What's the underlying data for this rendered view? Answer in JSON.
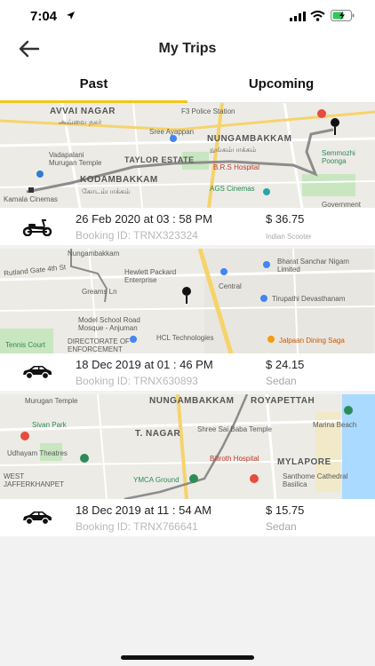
{
  "status_bar": {
    "time": "7:04",
    "icons": [
      "location-arrow-icon",
      "signal-icon",
      "wifi-icon",
      "battery-charging-icon"
    ]
  },
  "header": {
    "title": "My Trips",
    "back_icon": "arrow-left-icon"
  },
  "tabs": [
    {
      "label": "Past",
      "selected": true
    },
    {
      "label": "Upcoming",
      "selected": false
    }
  ],
  "colors": {
    "tab_indicator": "#f5c518",
    "route": "#8c8c8c",
    "map_park": "#c8e6c0",
    "map_road": "#f6d36b"
  },
  "trips": [
    {
      "vehicle_icon": "scooter-icon",
      "date": "26 Feb 2020 at 03 : 58 PM",
      "booking_id": "Booking ID: TRNX323324",
      "price": "$ 36.75",
      "vehicle_type": "Indian Scooter",
      "map_labels": {
        "avvai_nagar": "AVVAI NAGAR",
        "avvai_tamil": "அவ்வை நகர்",
        "vadapalani": "Vadapalani",
        "murugan": "Murugan Temple",
        "kamala": "Kamala Cinemas",
        "sree_ayappan": "Sree Ayappan",
        "taylor": "TAYLOR ESTATE",
        "kodambakkam": "KODAMBAKKAM",
        "kodambakkam_tamil": "கோடம்பாக்கம்",
        "police": "F3 Police Station",
        "nungambakkam": "NUNGAMBAKKAM",
        "nungambakkam_tamil": "நுங்கம்பாக்கம்",
        "brs": "B.R.S Hospital",
        "ags": "AGS Cinemas",
        "semmozhi": "Semmozhi Poonga",
        "government": "Government"
      }
    },
    {
      "vehicle_icon": "car-icon",
      "date": "18 Dec 2019 at 01 : 46 PM",
      "booking_id": "Booking ID: TRNX630893",
      "price": "$ 24.15",
      "vehicle_type": "Sedan",
      "map_labels": {
        "nungambakkam": "Nungambakkam",
        "rutland": "Rutland Gate 4th St",
        "hp": "Hewlett Packard Enterprise",
        "greams": "Greams Ln",
        "central": "Central",
        "bsnl": "Bharat Sanchar Nigam Limited",
        "tirupathi": "Tirupathi Devasthanam",
        "model_school": "Model School Road Mosque - Anjuman",
        "directorate": "DIRECTORATE OF ENFORCEMENT",
        "hcl": "HCL Technologies",
        "tennis": "Tennis Court",
        "jalpaan": "Jalpaan Dining Saga"
      }
    },
    {
      "vehicle_icon": "car-icon",
      "date": "18 Dec 2019 at 11 : 54 AM",
      "booking_id": "Booking ID: TRNX766641",
      "price": "$ 15.75",
      "vehicle_type": "Sedan",
      "map_labels": {
        "murugan": "Murugan Temple",
        "nungambakkam": "NUNGAMBAKKAM",
        "royapettah": "ROYAPETTAH",
        "sivan_park": "Sivan Park",
        "t_nagar": "T. NAGAR",
        "shree_sai": "Shree Sai Baba Temple",
        "udhayam": "Udhayam Theatres",
        "west_jafferkhanpet": "WEST JAFFERKHANPET",
        "billroth": "Billroth Hospital",
        "mylapore": "MYLAPORE",
        "marina": "Marina Beach",
        "santhome": "Santhome Cathedral Basilica",
        "ymca": "YMCA Ground"
      }
    }
  ]
}
